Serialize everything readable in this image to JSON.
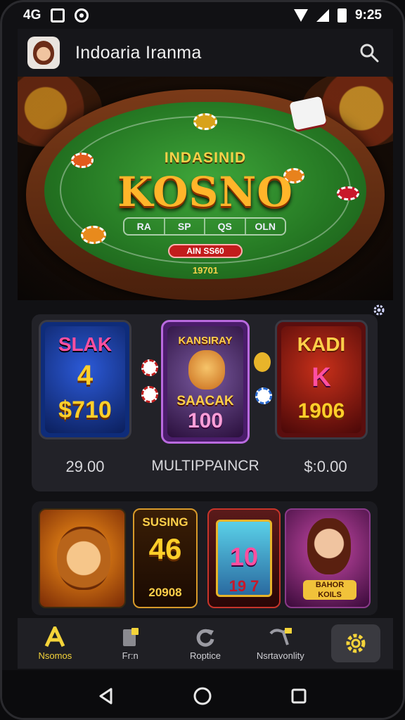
{
  "status_bar": {
    "network": "4G",
    "time": "9:25"
  },
  "header": {
    "title": "Indoaria Iranma"
  },
  "hero": {
    "subtitle": "INDASINID",
    "title": "KOSNO",
    "bet_cells": [
      "RA",
      "SP",
      "QS",
      "OLN"
    ],
    "badge": "AIN SS60",
    "small": "19701"
  },
  "promo": {
    "cards": [
      {
        "top": "SLAK",
        "mid": "4",
        "bottom": "$710"
      },
      {
        "top": "KANSIRAY",
        "mid": "SAACAK",
        "bottom": "100"
      },
      {
        "top": "KADI",
        "mid": "K",
        "bottom": "1906"
      }
    ],
    "labels": [
      "29.00",
      "MULTIPPAINCR",
      "$:0.00"
    ]
  },
  "games": [
    {
      "title": ""
    },
    {
      "top": "SUSING",
      "mid": "46",
      "bottom": "20908"
    },
    {
      "top": "",
      "mid": "10",
      "bottom": "19 7"
    },
    {
      "badge": "BAHOR KOILS"
    }
  ],
  "bottom_nav": {
    "items": [
      {
        "label": "Nsomos",
        "icon": "letter-a-icon",
        "active": true
      },
      {
        "label": "Fr:n",
        "icon": "card-icon"
      },
      {
        "label": "Roptice",
        "icon": "refresh-icon"
      },
      {
        "label": "Nsrtavonlity",
        "icon": "pen-icon"
      }
    ]
  },
  "colors": {
    "accent": "#f5d43a",
    "felt": "#2a8a28",
    "title_gold": "#ffb52a"
  }
}
